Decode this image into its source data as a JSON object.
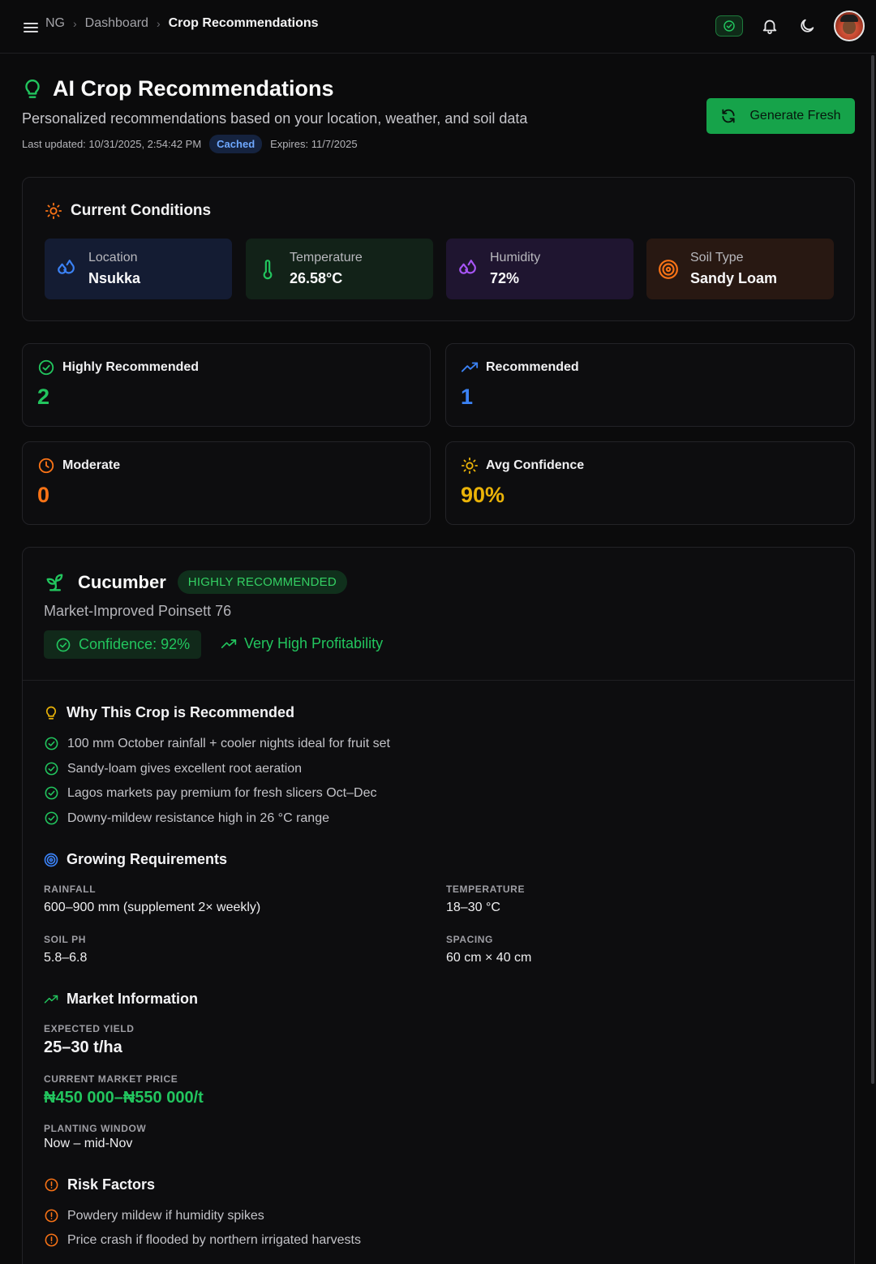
{
  "breadcrumb": {
    "root": "NG",
    "parent": "Dashboard",
    "current": "Crop Recommendations"
  },
  "header": {
    "title": "AI Crop Recommendations",
    "subtitle": "Personalized recommendations based on your location, weather, and soil data",
    "last_updated": "Last updated: 10/31/2025, 2:54:42 PM",
    "cache_badge": "Cached",
    "expires": "Expires: 11/7/2025",
    "generate_label": "Generate Fresh"
  },
  "conditions": {
    "title": "Current Conditions",
    "items": [
      {
        "label": "Location",
        "value": "Nsukka",
        "icon": "droplets-icon",
        "color": "#3b82f6"
      },
      {
        "label": "Temperature",
        "value": "26.58°C",
        "icon": "thermometer-icon",
        "color": "#22c55e"
      },
      {
        "label": "Humidity",
        "value": "72%",
        "icon": "droplets-icon",
        "color": "#a855f7"
      },
      {
        "label": "Soil Type",
        "value": "Sandy Loam",
        "icon": "target-icon",
        "color": "#f97316"
      }
    ]
  },
  "stats": {
    "highly": {
      "label": "Highly Recommended",
      "value": "2",
      "color": "#22c55e"
    },
    "recommended": {
      "label": "Recommended",
      "value": "1",
      "color": "#3b82f6"
    },
    "moderate": {
      "label": "Moderate",
      "value": "0",
      "color": "#f97316"
    },
    "confidence": {
      "label": "Avg Confidence",
      "value": "90%",
      "color": "#eab308"
    }
  },
  "crop": {
    "name": "Cucumber",
    "badge": "HIGHLY RECOMMENDED",
    "variety": "Market-Improved Poinsett 76",
    "confidence": "Confidence: 92%",
    "profitability": "Very High Profitability",
    "why_title": "Why This Crop is Recommended",
    "reasons": [
      "100 mm October rainfall + cooler nights ideal for fruit set",
      "Sandy-loam gives excellent root aeration",
      "Lagos markets pay premium for fresh slicers Oct–Dec",
      "Downy-mildew resistance high in 26 °C range"
    ],
    "growing_title": "Growing Requirements",
    "requirements": {
      "rainfall_label": "RAINFALL",
      "rainfall": "600–900 mm (supplement 2× weekly)",
      "temperature_label": "TEMPERATURE",
      "temperature": "18–30 °C",
      "soil_ph_label": "SOIL PH",
      "soil_ph": "5.8–6.8",
      "spacing_label": "SPACING",
      "spacing": "60 cm × 40 cm"
    },
    "market_title": "Market Information",
    "market": {
      "yield_label": "EXPECTED YIELD",
      "yield": "25–30 t/ha",
      "price_label": "CURRENT MARKET PRICE",
      "price": "₦450 000–₦550 000/t",
      "window_label": "PLANTING WINDOW",
      "window": "Now – mid-Nov"
    },
    "risk_title": "Risk Factors",
    "risks": [
      "Powdery mildew if humidity spikes",
      "Price crash if flooded by northern irrigated harvests"
    ]
  }
}
